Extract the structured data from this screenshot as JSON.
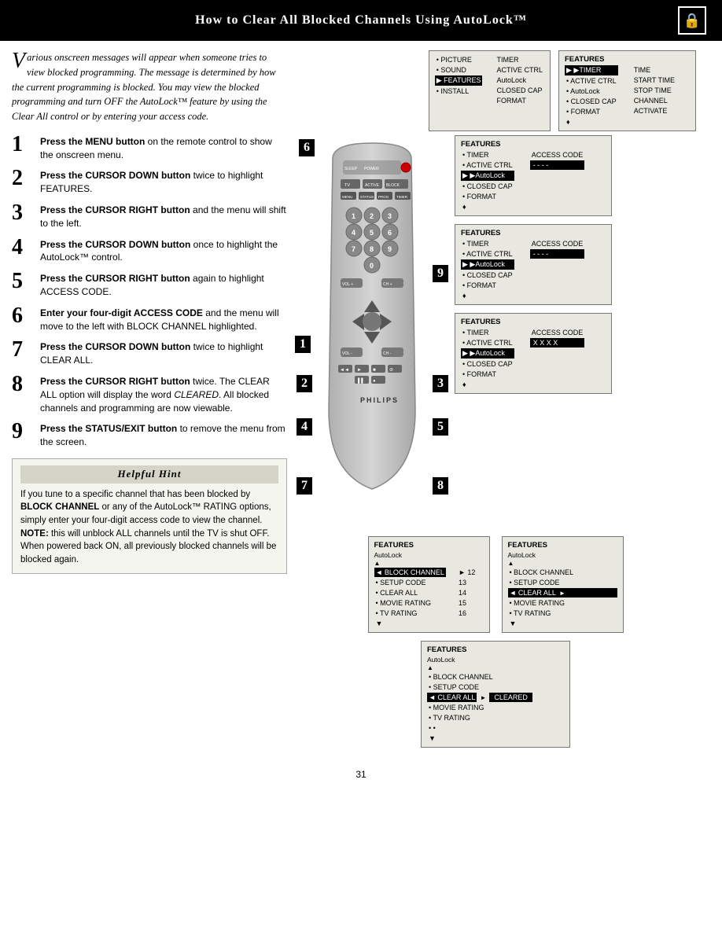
{
  "header": {
    "title": "How to Clear All Blocked Channels Using AutoLock™",
    "icon": "🔒"
  },
  "intro": {
    "dropcap": "V",
    "text": "arious onscreen messages will appear when someone tries to view blocked programming. The message is determined by how the current programming is blocked. You may view the blocked programming and turn OFF the AutoLock™ feature by using the Clear All control or by entering your access code."
  },
  "steps": [
    {
      "number": "1",
      "text": "Press the ",
      "bold": "MENU button",
      "rest": " on the remote control to show the onscreen menu."
    },
    {
      "number": "2",
      "text": "Press the ",
      "bold": "CURSOR DOWN button",
      "rest": " twice to highlight FEATURES."
    },
    {
      "number": "3",
      "text": "Press the ",
      "bold": "CURSOR RIGHT button",
      "rest": " and the menu will shift to the left."
    },
    {
      "number": "4",
      "text": "Press the ",
      "bold": "CURSOR DOWN button",
      "rest": " once to highlight the AutoLock™ control."
    },
    {
      "number": "5",
      "text": "Press the ",
      "bold": "CURSOR RIGHT button",
      "rest": " again to highlight ACCESS CODE."
    },
    {
      "number": "6",
      "text": "Enter your four-digit ",
      "bold": "ACCESS CODE",
      "rest": " and the menu will move to the left with BLOCK CHANNEL highlighted."
    },
    {
      "number": "7",
      "text": "Press the ",
      "bold": "CURSOR DOWN button",
      "rest": " twice to highlight CLEAR ALL."
    },
    {
      "number": "8",
      "text": "Press the ",
      "bold": "CURSOR RIGHT button",
      "rest": " twice. The CLEAR ALL option will display the word CLEARED. All blocked channels and programming are now viewable."
    },
    {
      "number": "9",
      "text": "Press the ",
      "bold": "STATUS/EXIT button",
      "rest": " to remove the menu from the screen."
    }
  ],
  "hint": {
    "title": "Helpful Hint",
    "text1": "If you tune to a specific channel that has been blocked by BLOCK CHANNEL or any of the AutoLock™ RATING options, simply enter your four-digit access code to view the channel.",
    "note_label": "NOTE:",
    "note_text": " this will unblock ALL channels until the TV is shut OFF. When powered back ON, all previously blocked channels will be blocked again."
  },
  "screens": {
    "main_menu": {
      "items_col1": [
        "• PICTURE",
        "• SOUND",
        "▶ FEATURES",
        "• INSTALL"
      ],
      "items_col2": [
        "TIMER",
        "ACTIVE CTRL",
        "AutoLock",
        "CLOSED CAP",
        "FORMAT"
      ]
    },
    "features_timer": {
      "title": "FEATURES",
      "items": [
        "▶TIMER",
        "• ACTIVE CTRL",
        "• AutoLock",
        "• CLOSED CAP",
        "• FORMAT",
        "♦"
      ],
      "right": [
        "TIME",
        "START TIME",
        "STOP TIME",
        "CHANNEL",
        "ACTIVATE"
      ]
    },
    "features_autolock": {
      "title": "FEATURES",
      "items": [
        "• TIMER",
        "• ACTIVE CTRL",
        "▶AutoLock",
        "• CLOSED CAP",
        "• FORMAT",
        "♦"
      ],
      "right_label": "ACCESS CODE",
      "right_val": "- - - -"
    },
    "features_autolock2": {
      "title": "FEATURES",
      "items": [
        "• TIMER",
        "• ACTIVE CTRL",
        "▶AutoLock",
        "• CLOSED CAP",
        "• FORMAT",
        "♦"
      ],
      "right_label": "ACCESS CODE",
      "right_val": "- - - -"
    },
    "features_xxxx": {
      "title": "FEATURES",
      "items": [
        "• TIMER",
        "• ACTIVE CTRL",
        "▶AutoLock",
        "• CLOSED CAP",
        "• FORMAT",
        "♦"
      ],
      "right_label": "ACCESS CODE",
      "right_val": "X X X X"
    },
    "autolock_block": {
      "title": "FEATURES",
      "sub": "AutoLock",
      "items": [
        "◄ BLOCK CHANNEL",
        "• SETUP CODE",
        "• CLEAR ALL",
        "• MOVIE RATING",
        "• TV RATING",
        "♦"
      ],
      "nums": [
        "12",
        "13",
        "14",
        "15",
        "16"
      ]
    },
    "autolock_clear": {
      "title": "FEATURES",
      "sub": "AutoLock",
      "items": [
        "• BLOCK CHANNEL",
        "• SETUP CODE",
        "◄ CLEAR ALL",
        "• MOVIE RATING",
        "• TV RATING"
      ],
      "clear_arrow": "►"
    },
    "autolock_cleared": {
      "title": "FEATURES",
      "sub": "AutoLock",
      "items": [
        "• BLOCK CHANNEL",
        "• SETUP CODE",
        "◄ CLEAR ALL",
        "• MOVIE RATING",
        "• TV RATING",
        "•"
      ],
      "cleared_label": "CLEARED"
    }
  },
  "page_number": "31",
  "remote": {
    "brand": "PHILIPS"
  }
}
